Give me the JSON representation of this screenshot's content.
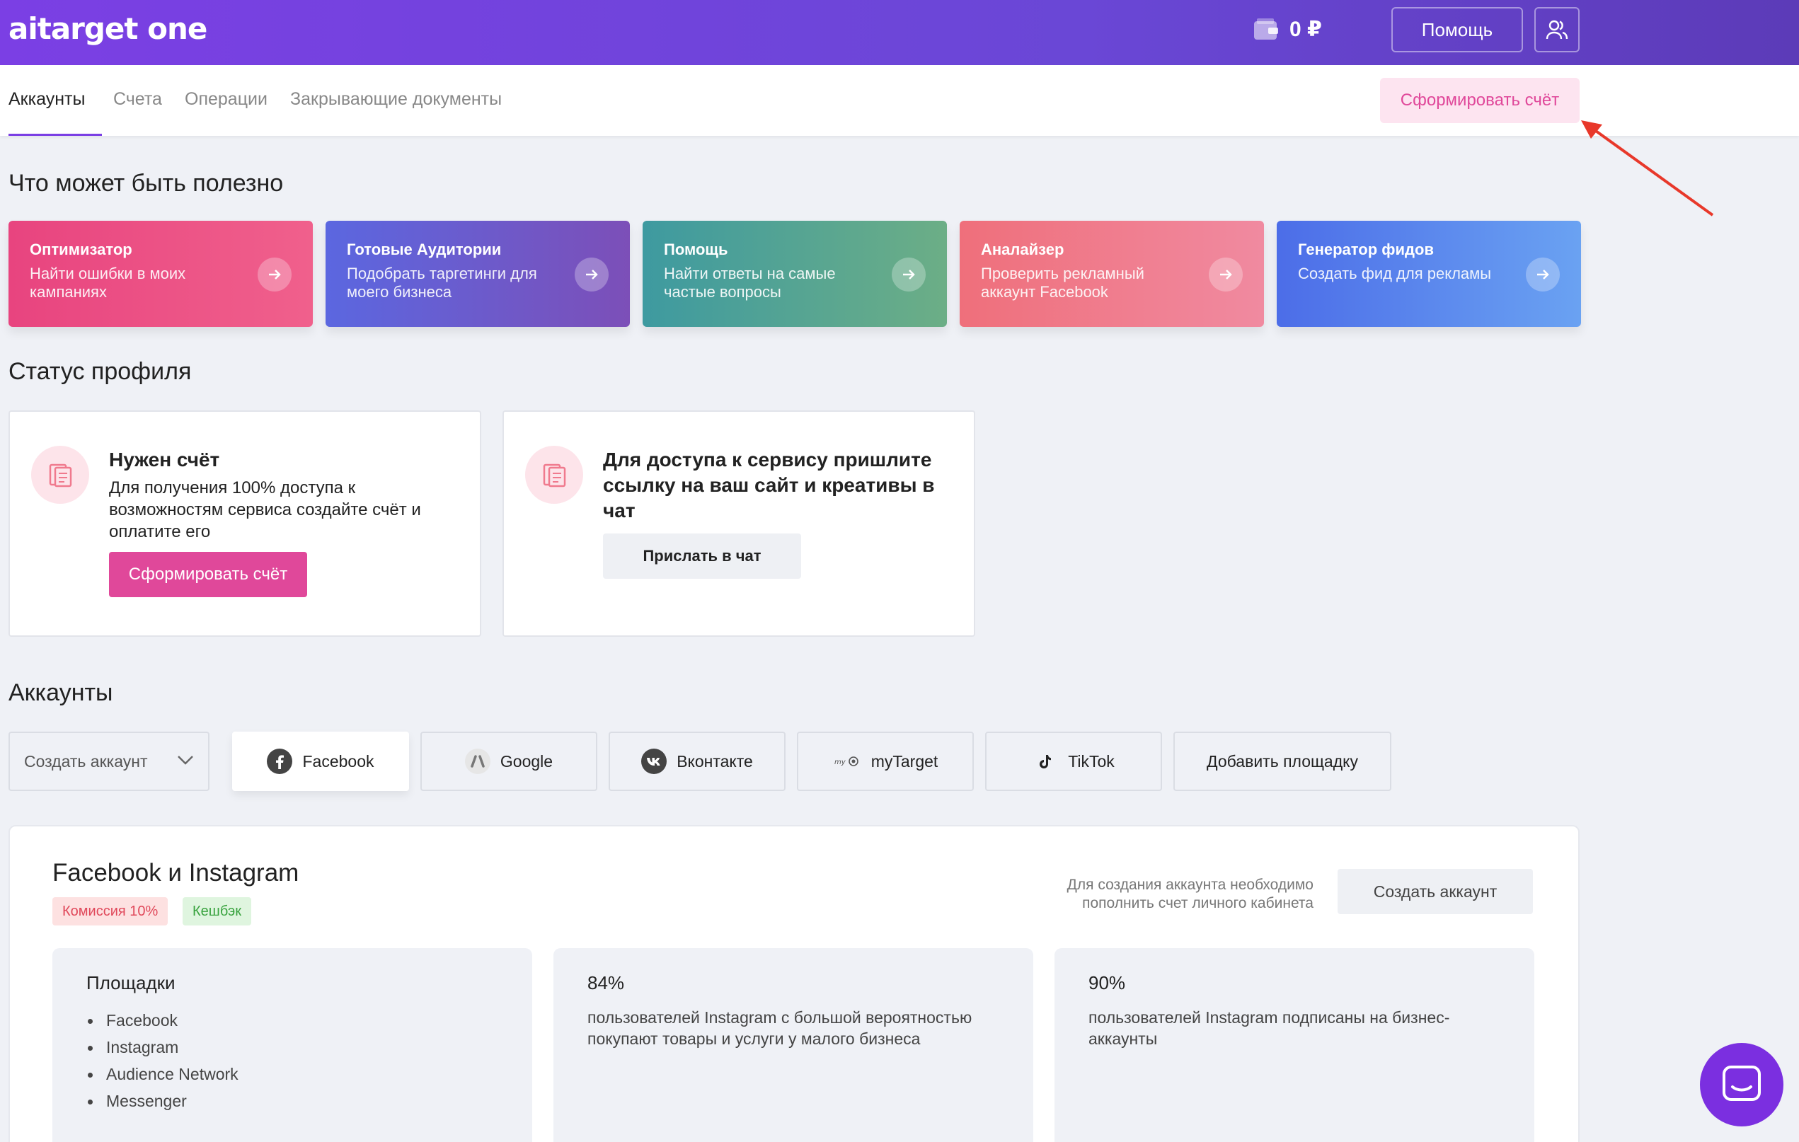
{
  "header": {
    "logo": "aitarget one",
    "balance": "0 ₽",
    "help_label": "Помощь"
  },
  "tabs": {
    "items": [
      {
        "label": "Аккаунты",
        "active": true
      },
      {
        "label": "Счета",
        "active": false
      },
      {
        "label": "Операции",
        "active": false
      },
      {
        "label": "Закрывающие документы",
        "active": false
      }
    ],
    "invoice_button": "Сформировать счёт"
  },
  "useful": {
    "heading": "Что может быть полезно",
    "cards": [
      {
        "title": "Оптимизатор",
        "desc": "Найти ошибки в моих кампаниях"
      },
      {
        "title": "Готовые Аудитории",
        "desc": "Подобрать таргетинги для моего бизнеса"
      },
      {
        "title": "Помощь",
        "desc": "Найти ответы на самые частые вопросы"
      },
      {
        "title": "Аналайзер",
        "desc": "Проверить рекламный аккаунт Facebook"
      },
      {
        "title": "Генератор фидов",
        "desc": "Создать фид для рекламы"
      }
    ]
  },
  "profile_status": {
    "heading": "Статус профиля",
    "card1": {
      "title": "Нужен счёт",
      "desc": "Для получения 100% доступа к возможностям сервиса создайте счёт и оплатите его",
      "button": "Сформировать счёт"
    },
    "card2": {
      "title": "Для доступа к сервису пришлите ссылку на ваш сайт и креативы в чат",
      "button": "Прислать в чат"
    }
  },
  "accounts": {
    "heading": "Аккаунты",
    "create_select": "Создать аккаунт",
    "platforms": [
      {
        "label": "Facebook",
        "active": true
      },
      {
        "label": "Google",
        "active": false
      },
      {
        "label": "Вконтакте",
        "active": false
      },
      {
        "label": "myTarget",
        "active": false
      },
      {
        "label": "TikTok",
        "active": false
      }
    ],
    "add_platform": "Добавить площадку"
  },
  "panel": {
    "title": "Facebook и Instagram",
    "badge_commission": "Комиссия 10%",
    "badge_cashback": "Кешбэк",
    "note": "Для создания аккаунта необходимо пополнить счет личного кабинета",
    "create_button": "Создать аккаунт",
    "platforms_heading": "Площадки",
    "platforms_list": [
      "Facebook",
      "Instagram",
      "Audience Network",
      "Messenger"
    ],
    "stat1": {
      "value": "84%",
      "text": "пользователей Instagram с большой вероятностью покупают товары и услуги у малого бизнеса"
    },
    "stat2": {
      "value": "90%",
      "text": "пользователей Instagram подписаны на бизнес-аккаунты"
    }
  },
  "colors": {
    "header_gradient_start": "#7b3fe4",
    "accent_pink": "#e0489a",
    "arrow_red": "#e8382a"
  }
}
